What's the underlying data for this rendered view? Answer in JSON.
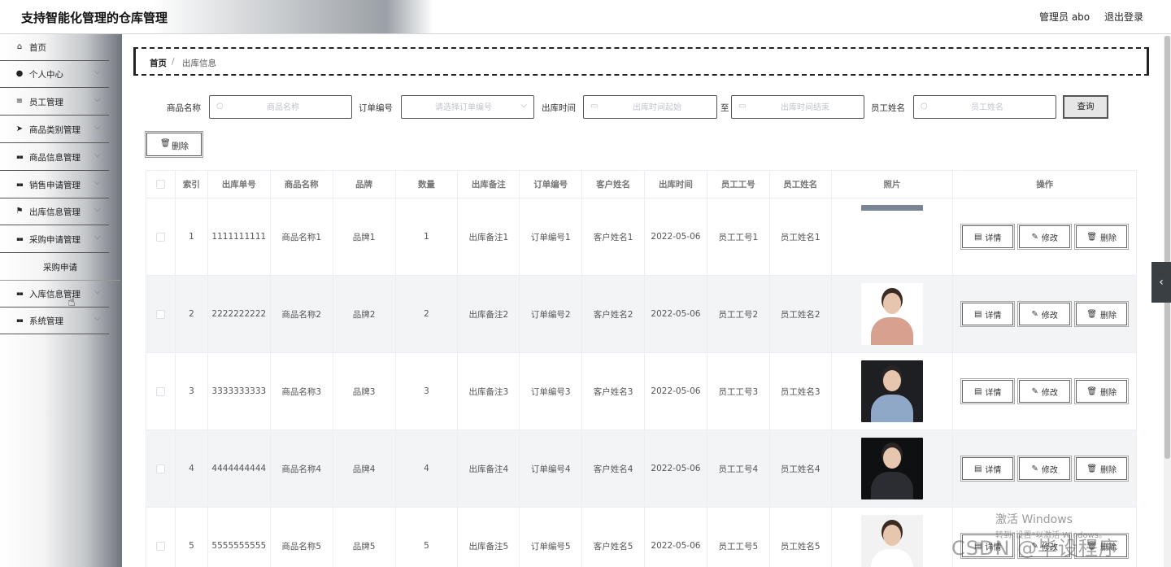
{
  "header": {
    "title": "支持智能化管理的仓库管理",
    "user": "管理员 abo",
    "logout": "退出登录"
  },
  "sidebar": {
    "items": [
      {
        "label": "首页",
        "icon": "home-icon",
        "has_chevron": false
      },
      {
        "label": "个人中心",
        "icon": "user-icon",
        "has_chevron": true
      },
      {
        "label": "员工管理",
        "icon": "list-icon",
        "has_chevron": true
      },
      {
        "label": "商品类别管理",
        "icon": "send-icon",
        "has_chevron": true
      },
      {
        "label": "商品信息管理",
        "icon": "grid-icon",
        "has_chevron": true
      },
      {
        "label": "销售申请管理",
        "icon": "grid-icon",
        "has_chevron": true
      },
      {
        "label": "出库信息管理",
        "icon": "flag-icon",
        "has_chevron": true
      },
      {
        "label": "采购申请管理",
        "icon": "grid-icon",
        "has_chevron": true
      },
      {
        "label": "入库信息管理",
        "icon": "grid-icon",
        "has_chevron": true
      },
      {
        "label": "系统管理",
        "icon": "grid-icon",
        "has_chevron": true
      }
    ],
    "submenu": {
      "label": "采购申请"
    }
  },
  "breadcrumb": {
    "home": "首页",
    "separator": "/",
    "current": "出库信息"
  },
  "search": {
    "product_name_label": "商品名称",
    "product_name_placeholder": "商品名称",
    "order_no_label": "订单编号",
    "order_no_placeholder": "请选择订单编号",
    "time_label": "出库时间",
    "time_start_placeholder": "出库时间起始",
    "time_to": "至",
    "time_end_placeholder": "出库时间结束",
    "employee_label": "员工姓名",
    "employee_placeholder": "员工姓名",
    "query_button": "查询"
  },
  "toolbar": {
    "delete_button": "删除"
  },
  "table": {
    "columns": [
      "索引",
      "出库单号",
      "商品名称",
      "品牌",
      "数量",
      "出库备注",
      "订单编号",
      "客户姓名",
      "出库时间",
      "员工工号",
      "员工姓名",
      "照片",
      "操作"
    ],
    "rows": [
      {
        "index": "1",
        "no": "1111111111",
        "name": "商品名称1",
        "brand": "品牌1",
        "qty": "1",
        "note": "出库备注1",
        "order": "订单编号1",
        "customer": "客户姓名1",
        "time": "2022-05-06",
        "emp_id": "员工工号1",
        "emp_name": "员工姓名1",
        "photo": "partial"
      },
      {
        "index": "2",
        "no": "2222222222",
        "name": "商品名称2",
        "brand": "品牌2",
        "qty": "2",
        "note": "出库备注2",
        "order": "订单编号2",
        "customer": "客户姓名2",
        "time": "2022-05-06",
        "emp_id": "员工工号2",
        "emp_name": "员工姓名2",
        "photo": "woman-pink"
      },
      {
        "index": "3",
        "no": "3333333333",
        "name": "商品名称3",
        "brand": "品牌3",
        "qty": "3",
        "note": "出库备注3",
        "order": "订单编号3",
        "customer": "客户姓名3",
        "time": "2022-05-06",
        "emp_id": "员工工号3",
        "emp_name": "员工姓名3",
        "photo": "man-blue"
      },
      {
        "index": "4",
        "no": "4444444444",
        "name": "商品名称4",
        "brand": "品牌4",
        "qty": "4",
        "note": "出库备注4",
        "order": "订单编号4",
        "customer": "客户姓名4",
        "time": "2022-05-06",
        "emp_id": "员工工号4",
        "emp_name": "员工姓名4",
        "photo": "man-suit"
      },
      {
        "index": "5",
        "no": "5555555555",
        "name": "商品名称5",
        "brand": "品牌5",
        "qty": "5",
        "note": "出库备注5",
        "order": "订单编号5",
        "customer": "客户姓名5",
        "time": "2022-05-06",
        "emp_id": "员工工号5",
        "emp_name": "员工姓名5",
        "photo": "woman-white"
      }
    ],
    "actions": {
      "detail": "详情",
      "edit": "修改",
      "delete": "删除"
    }
  },
  "watermarks": {
    "activate_title": "激活 Windows",
    "activate_sub": "转到\"设置\"以激活 Windows。",
    "csdn": "CSDN @毕设程序"
  },
  "colors": {
    "sidebar_dark": "#70757c",
    "row_alt": "#f3f4f6",
    "side_tab": "#3a3f44"
  }
}
